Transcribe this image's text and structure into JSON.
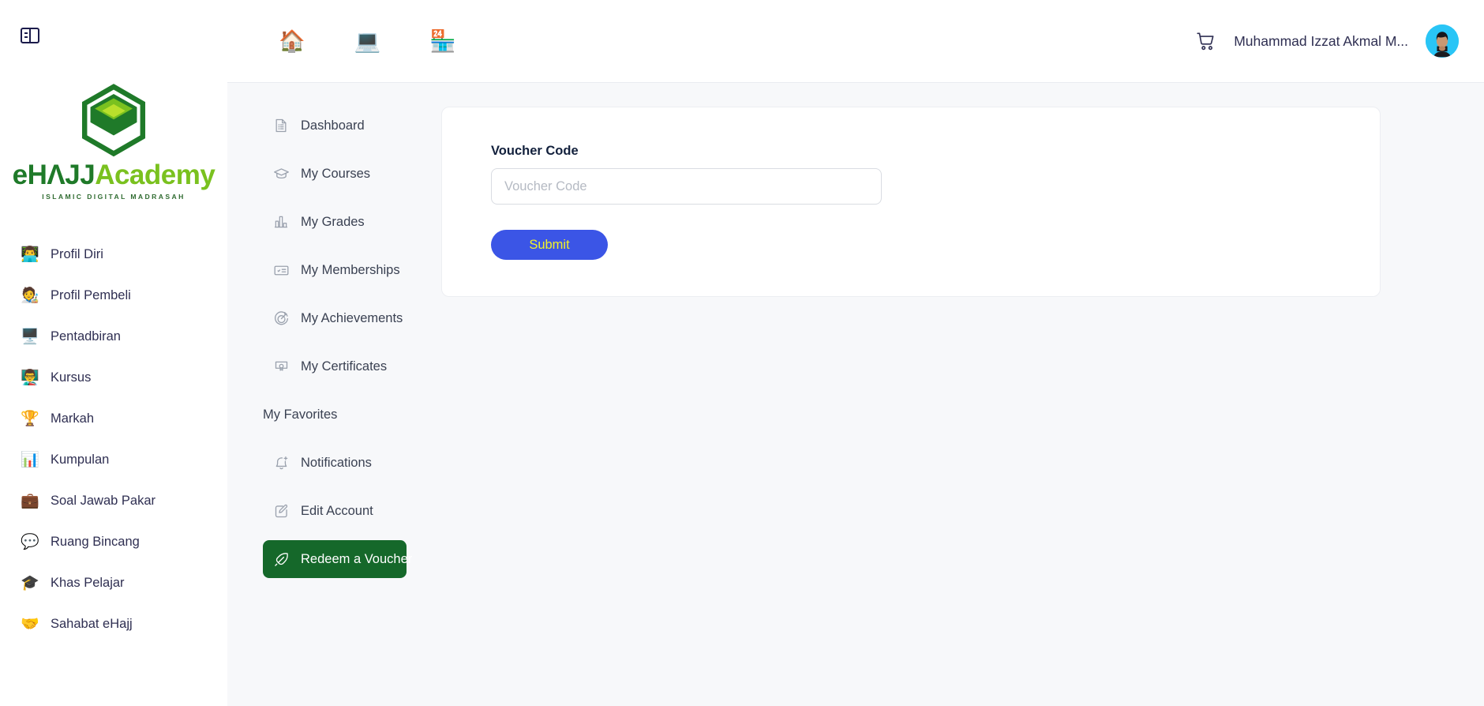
{
  "colors": {
    "active_green": "#15682a",
    "submit_blue": "#3b55e6",
    "submit_text_yellow": "#f2f227",
    "avatar_bg": "#29c5f6",
    "logo_dark_green": "#1f7a29",
    "logo_light_green": "#7ac11f",
    "page_bg": "#f7f8fa"
  },
  "sidebar": {
    "toggle_icon": "sidebar-panel-icon",
    "logo": {
      "name_part1": "eHΛJJ",
      "name_part2": "Academy",
      "tagline": "ISLAMIC DIGITAL MADRASAH"
    },
    "items": [
      {
        "label": "Profil Diri",
        "icon": "user-profile-icon",
        "emoji": "👨‍💻"
      },
      {
        "label": "Profil Pembeli",
        "icon": "buyer-profile-icon",
        "emoji": "🧑‍🎨"
      },
      {
        "label": "Pentadbiran",
        "icon": "administration-icon",
        "emoji": "🖥️"
      },
      {
        "label": "Kursus",
        "icon": "courses-icon",
        "emoji": "👨‍🏫"
      },
      {
        "label": "Markah",
        "icon": "marks-icon",
        "emoji": "🏆"
      },
      {
        "label": "Kumpulan",
        "icon": "groups-icon",
        "emoji": "📊"
      },
      {
        "label": "Soal Jawab Pakar",
        "icon": "expert-qa-icon",
        "emoji": "💼"
      },
      {
        "label": "Ruang Bincang",
        "icon": "discussion-room-icon",
        "emoji": "💬"
      },
      {
        "label": "Khas Pelajar",
        "icon": "student-special-icon",
        "emoji": "🎓"
      },
      {
        "label": "Sahabat eHajj",
        "icon": "friends-icon",
        "emoji": "🤝"
      }
    ]
  },
  "topbar": {
    "icons": [
      {
        "name": "home-icon",
        "emoji": "🏠"
      },
      {
        "name": "profile-laptop-icon",
        "emoji": "💻"
      },
      {
        "name": "store-icon",
        "emoji": "🏪"
      }
    ],
    "cart_icon": "shopping-cart-icon",
    "user_name": "Muhammad Izzat Akmal M...",
    "avatar": "user-avatar"
  },
  "subnav": {
    "items": [
      {
        "label": "Dashboard",
        "icon": "dashboard-list-icon",
        "active": false,
        "type": "link"
      },
      {
        "label": "My Courses",
        "icon": "graduation-cap-icon",
        "active": false,
        "type": "link"
      },
      {
        "label": "My Grades",
        "icon": "bar-chart-icon",
        "active": false,
        "type": "link"
      },
      {
        "label": "My Memberships",
        "icon": "membership-card-icon",
        "active": false,
        "type": "link"
      },
      {
        "label": "My Achievements",
        "icon": "target-achievement-icon",
        "active": false,
        "type": "link"
      },
      {
        "label": "My Certificates",
        "icon": "certificate-seal-icon",
        "active": false,
        "type": "link"
      },
      {
        "label": "My Favorites",
        "icon": null,
        "active": false,
        "type": "section"
      },
      {
        "label": "Notifications",
        "icon": "bell-plus-icon",
        "active": false,
        "type": "link"
      },
      {
        "label": "Edit Account",
        "icon": "edit-square-icon",
        "active": false,
        "type": "link"
      },
      {
        "label": "Redeem a Voucher",
        "icon": "rocket-icon",
        "active": true,
        "type": "link"
      }
    ]
  },
  "main": {
    "voucher_label": "Voucher Code",
    "voucher_value": "",
    "voucher_placeholder": "Voucher Code",
    "submit_label": "Submit"
  }
}
